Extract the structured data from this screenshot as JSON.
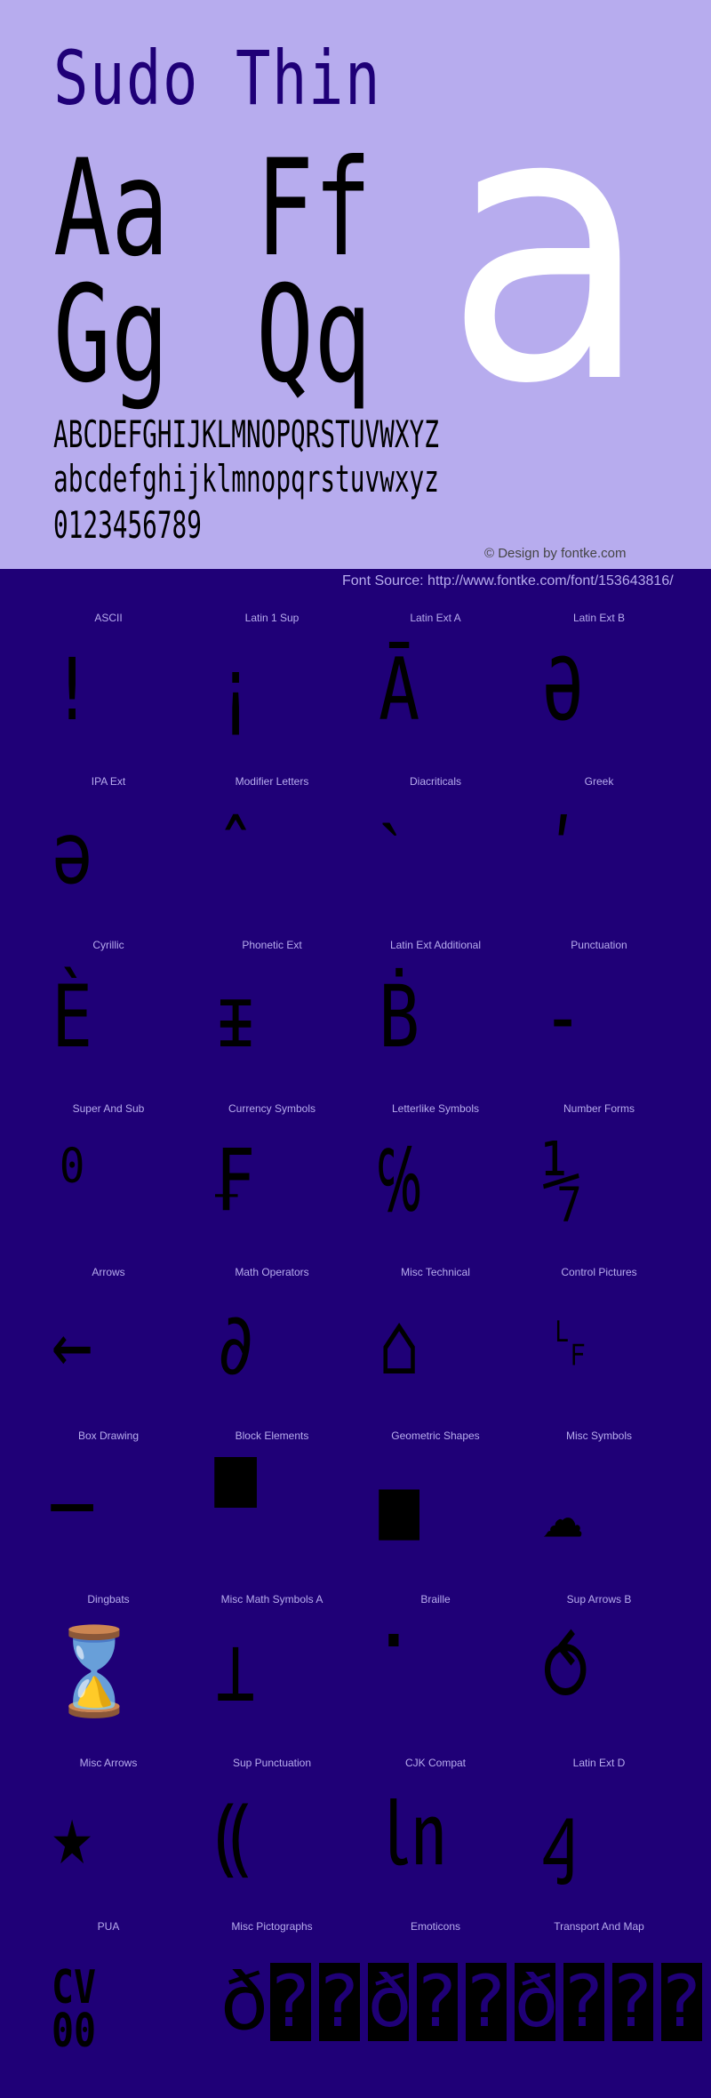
{
  "colors": {
    "top_bg": "#b7acee",
    "bottom_bg": "#1f0077",
    "title": "#1f0077",
    "glyph": "#000000",
    "big_glyph": "#ffffff",
    "label": "#b7acee"
  },
  "header": {
    "title": "Sudo Thin",
    "pair_1": "Aa",
    "pair_2": "Ff",
    "pair_3": "Gg",
    "pair_4": "Qq",
    "big_glyph": "a",
    "uppercase": "ABCDEFGHIJKLMNOPQRSTUVWXYZ",
    "lowercase": "abcdefghijklmnopqrstuvwxyz",
    "digits": "0123456789",
    "copyright": "© Design by fontke.com"
  },
  "source": "Font Source: http://www.fontke.com/font/153643816/",
  "blocks": [
    {
      "label": "ASCII",
      "glyph": "!"
    },
    {
      "label": "Latin 1 Sup",
      "glyph": "¡"
    },
    {
      "label": "Latin Ext A",
      "glyph": "Ā"
    },
    {
      "label": "Latin Ext B",
      "glyph": "Ə"
    },
    {
      "label": "IPA Ext",
      "glyph": "ə"
    },
    {
      "label": "Modifier Letters",
      "glyph": "ˆ"
    },
    {
      "label": "Diacriticals",
      "glyph": "ˋ"
    },
    {
      "label": "Greek",
      "glyph": "ʹ"
    },
    {
      "label": "Cyrillic",
      "glyph": "Ѐ"
    },
    {
      "label": "Phonetic Ext",
      "glyph": "ᵻ"
    },
    {
      "label": "Latin Ext Additional",
      "glyph": "Ḃ"
    },
    {
      "label": "Punctuation",
      "glyph": "‐"
    },
    {
      "label": "Super And Sub",
      "glyph": "⁰"
    },
    {
      "label": "Currency Symbols",
      "glyph": "₣"
    },
    {
      "label": "Letterlike Symbols",
      "glyph": "℅"
    },
    {
      "label": "Number Forms",
      "glyph": "⅐"
    },
    {
      "label": "Arrows",
      "glyph": "←"
    },
    {
      "label": "Math Operators",
      "glyph": "∂"
    },
    {
      "label": "Misc Technical",
      "glyph": "⌂"
    },
    {
      "label": "Control Pictures",
      "glyph": "␊"
    },
    {
      "label": "Box Drawing",
      "glyph": "─"
    },
    {
      "label": "Block Elements",
      "glyph": "▀"
    },
    {
      "label": "Geometric Shapes",
      "glyph": "■"
    },
    {
      "label": "Misc Symbols",
      "glyph": "☁"
    },
    {
      "label": "Dingbats",
      "glyph": "⌛"
    },
    {
      "label": "Misc Math Symbols A",
      "glyph": "⊥"
    },
    {
      "label": "Braille",
      "glyph": "⠁"
    },
    {
      "label": "Sup Arrows B",
      "glyph": "⥀"
    },
    {
      "label": "Misc Arrows",
      "glyph": "★"
    },
    {
      "label": "Sup Punctuation",
      "glyph": "⸨"
    },
    {
      "label": "CJK Compat",
      "glyph": "㏑"
    },
    {
      "label": "Latin Ext D",
      "glyph": "ꜭ"
    },
    {
      "label": "PUA",
      "glyph": "CV00"
    },
    {
      "label": "Misc Pictographs",
      "glyph": "ð"
    },
    {
      "label": "Emoticons",
      "glyph": ""
    },
    {
      "label": "Transport And Map",
      "glyph": ""
    }
  ],
  "fallback_row": {
    "lead_glyph": "ð",
    "tofu_glyph": "?",
    "sequence": [
      "?",
      "?",
      "ð",
      "?",
      "?",
      "ð",
      "?",
      "?",
      "?"
    ]
  }
}
